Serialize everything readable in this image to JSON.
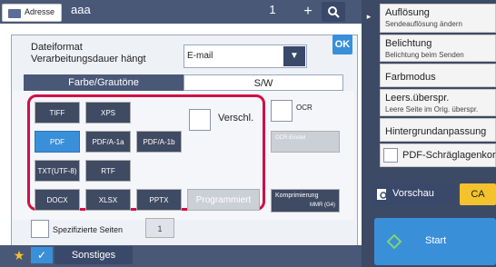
{
  "header": {
    "address_label": "Adresse",
    "address_value": "aaa",
    "count": "1",
    "add_symbol": "+",
    "search_symbol": "⌕"
  },
  "main": {
    "file_format_label": "Dateiformat",
    "processing_label": "Verarbeitungsdauer hängt",
    "format_select_value": "E-mail",
    "ok_label": "OK",
    "tabs": [
      {
        "label": "Farbe/Grautöne"
      },
      {
        "label": "S/W"
      }
    ],
    "formats": {
      "tiff": "TIFF",
      "xps": "XPS",
      "pdf": "PDF",
      "pdfa1a": "PDF/A-1a",
      "pdfa1b": "PDF/A-1b",
      "txt": "TXT(UTF-8)",
      "rtf": "RTF",
      "docx": "DOCX",
      "xlsx": "XLSX",
      "pptx": "PPTX"
    },
    "encrypt_label": "Verschl.",
    "ocr_label": "OCR",
    "ocr_settings_label": "OCR-Einstel",
    "programmed_label": "Programmiert",
    "compression_label": "Komprimierung",
    "compression_value": "MMR (G4)",
    "specified_pages_label": "Spezifizierte Seiten",
    "specified_pages_value": "1"
  },
  "right_panel": {
    "items": [
      {
        "title": "Auflösung",
        "subtitle": "Sendeauflösung ändern"
      },
      {
        "title": "Belichtung",
        "subtitle": "Belichtung beim Senden"
      },
      {
        "title": "Farbmodus"
      },
      {
        "title": "Leers.überspr.",
        "subtitle": "Leere Seite im Orig. überspr."
      },
      {
        "title": "Hintergrundanpassung"
      },
      {
        "title": "PDF-Schräglagenkorr"
      }
    ],
    "preview_label": "Vorschau",
    "ca_label": "CA",
    "start_label": "Start"
  },
  "footer": {
    "other_label": "Sonstiges"
  },
  "colors": {
    "header_bg": "#4a5878",
    "side_panel_bg": "#3d4a66",
    "accent_blue": "#3a8fd9",
    "highlight_red": "#d10f45",
    "ca_yellow": "#f3c22c"
  }
}
